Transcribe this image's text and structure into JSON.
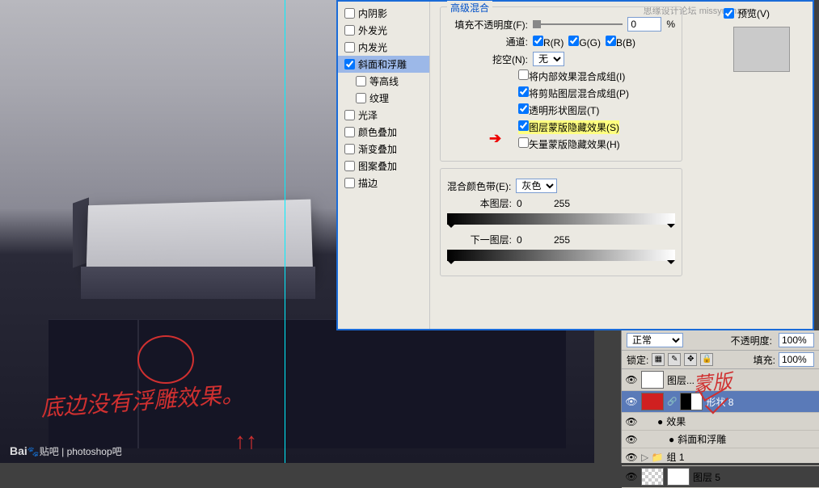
{
  "watermarks": {
    "bottom_logo": "Bai",
    "bottom_logo2": "贴吧",
    "bottom_text": "photoshop吧",
    "top_right": "思缘设计论坛 missyuan.com"
  },
  "annotations": {
    "main": "底边没有浮雕效果。",
    "mask_label": "蒙版",
    "arrow_up": "↑↑"
  },
  "layer_style": {
    "left_items": [
      {
        "label": "内阴影",
        "checked": false,
        "sub": false
      },
      {
        "label": "外发光",
        "checked": false,
        "sub": false
      },
      {
        "label": "内发光",
        "checked": false,
        "sub": false
      },
      {
        "label": "斜面和浮雕",
        "checked": true,
        "sub": false,
        "active": true
      },
      {
        "label": "等高线",
        "checked": false,
        "sub": true
      },
      {
        "label": "纹理",
        "checked": false,
        "sub": true
      },
      {
        "label": "光泽",
        "checked": false,
        "sub": false
      },
      {
        "label": "颜色叠加",
        "checked": false,
        "sub": false
      },
      {
        "label": "渐变叠加",
        "checked": false,
        "sub": false
      },
      {
        "label": "图案叠加",
        "checked": false,
        "sub": false
      },
      {
        "label": "描边",
        "checked": false,
        "sub": false
      }
    ],
    "preview_label": "预览(V)",
    "blend_group": {
      "title": "高级混合",
      "fill_opacity_label": "填充不透明度(F):",
      "fill_opacity_value": "0",
      "percent": "%",
      "channels_label": "通道:",
      "channels": [
        {
          "n": "R(R)",
          "c": true
        },
        {
          "n": "G(G)",
          "c": true
        },
        {
          "n": "B(B)",
          "c": true
        }
      ],
      "knockout_label": "挖空(N):",
      "knockout_value": "无",
      "opts": [
        {
          "label": "将内部效果混合成组(I)",
          "checked": false
        },
        {
          "label": "将剪贴图层混合成组(P)",
          "checked": true
        },
        {
          "label": "透明形状图层(T)",
          "checked": true
        },
        {
          "label": "图层蒙版隐藏效果(S)",
          "checked": true,
          "highlight": true
        },
        {
          "label": "矢量蒙版隐藏效果(H)",
          "checked": false
        }
      ]
    },
    "blendif": {
      "label": "混合颜色带(E):",
      "channel": "灰色",
      "this_label": "本图层:",
      "this_vals": [
        "0",
        "255"
      ],
      "under_label": "下一图层:",
      "under_vals": [
        "0",
        "255"
      ]
    }
  },
  "layers_panel": {
    "mode": "正常",
    "opacity_label": "不透明度:",
    "opacity": "100%",
    "lock_label": "锁定:",
    "fill_label": "填充:",
    "fill": "100%",
    "layers": [
      {
        "name": "图层...",
        "type": "layer",
        "vis": true
      },
      {
        "name": "形状 8",
        "type": "shape",
        "vis": true,
        "sel": true
      },
      {
        "name": "效果",
        "type": "fx",
        "vis": true
      },
      {
        "name": "斜面和浮雕",
        "type": "fx-item",
        "vis": true
      },
      {
        "name": "组 1",
        "type": "group",
        "vis": true
      },
      {
        "name": "图层 5",
        "type": "layer",
        "vis": true
      }
    ]
  }
}
